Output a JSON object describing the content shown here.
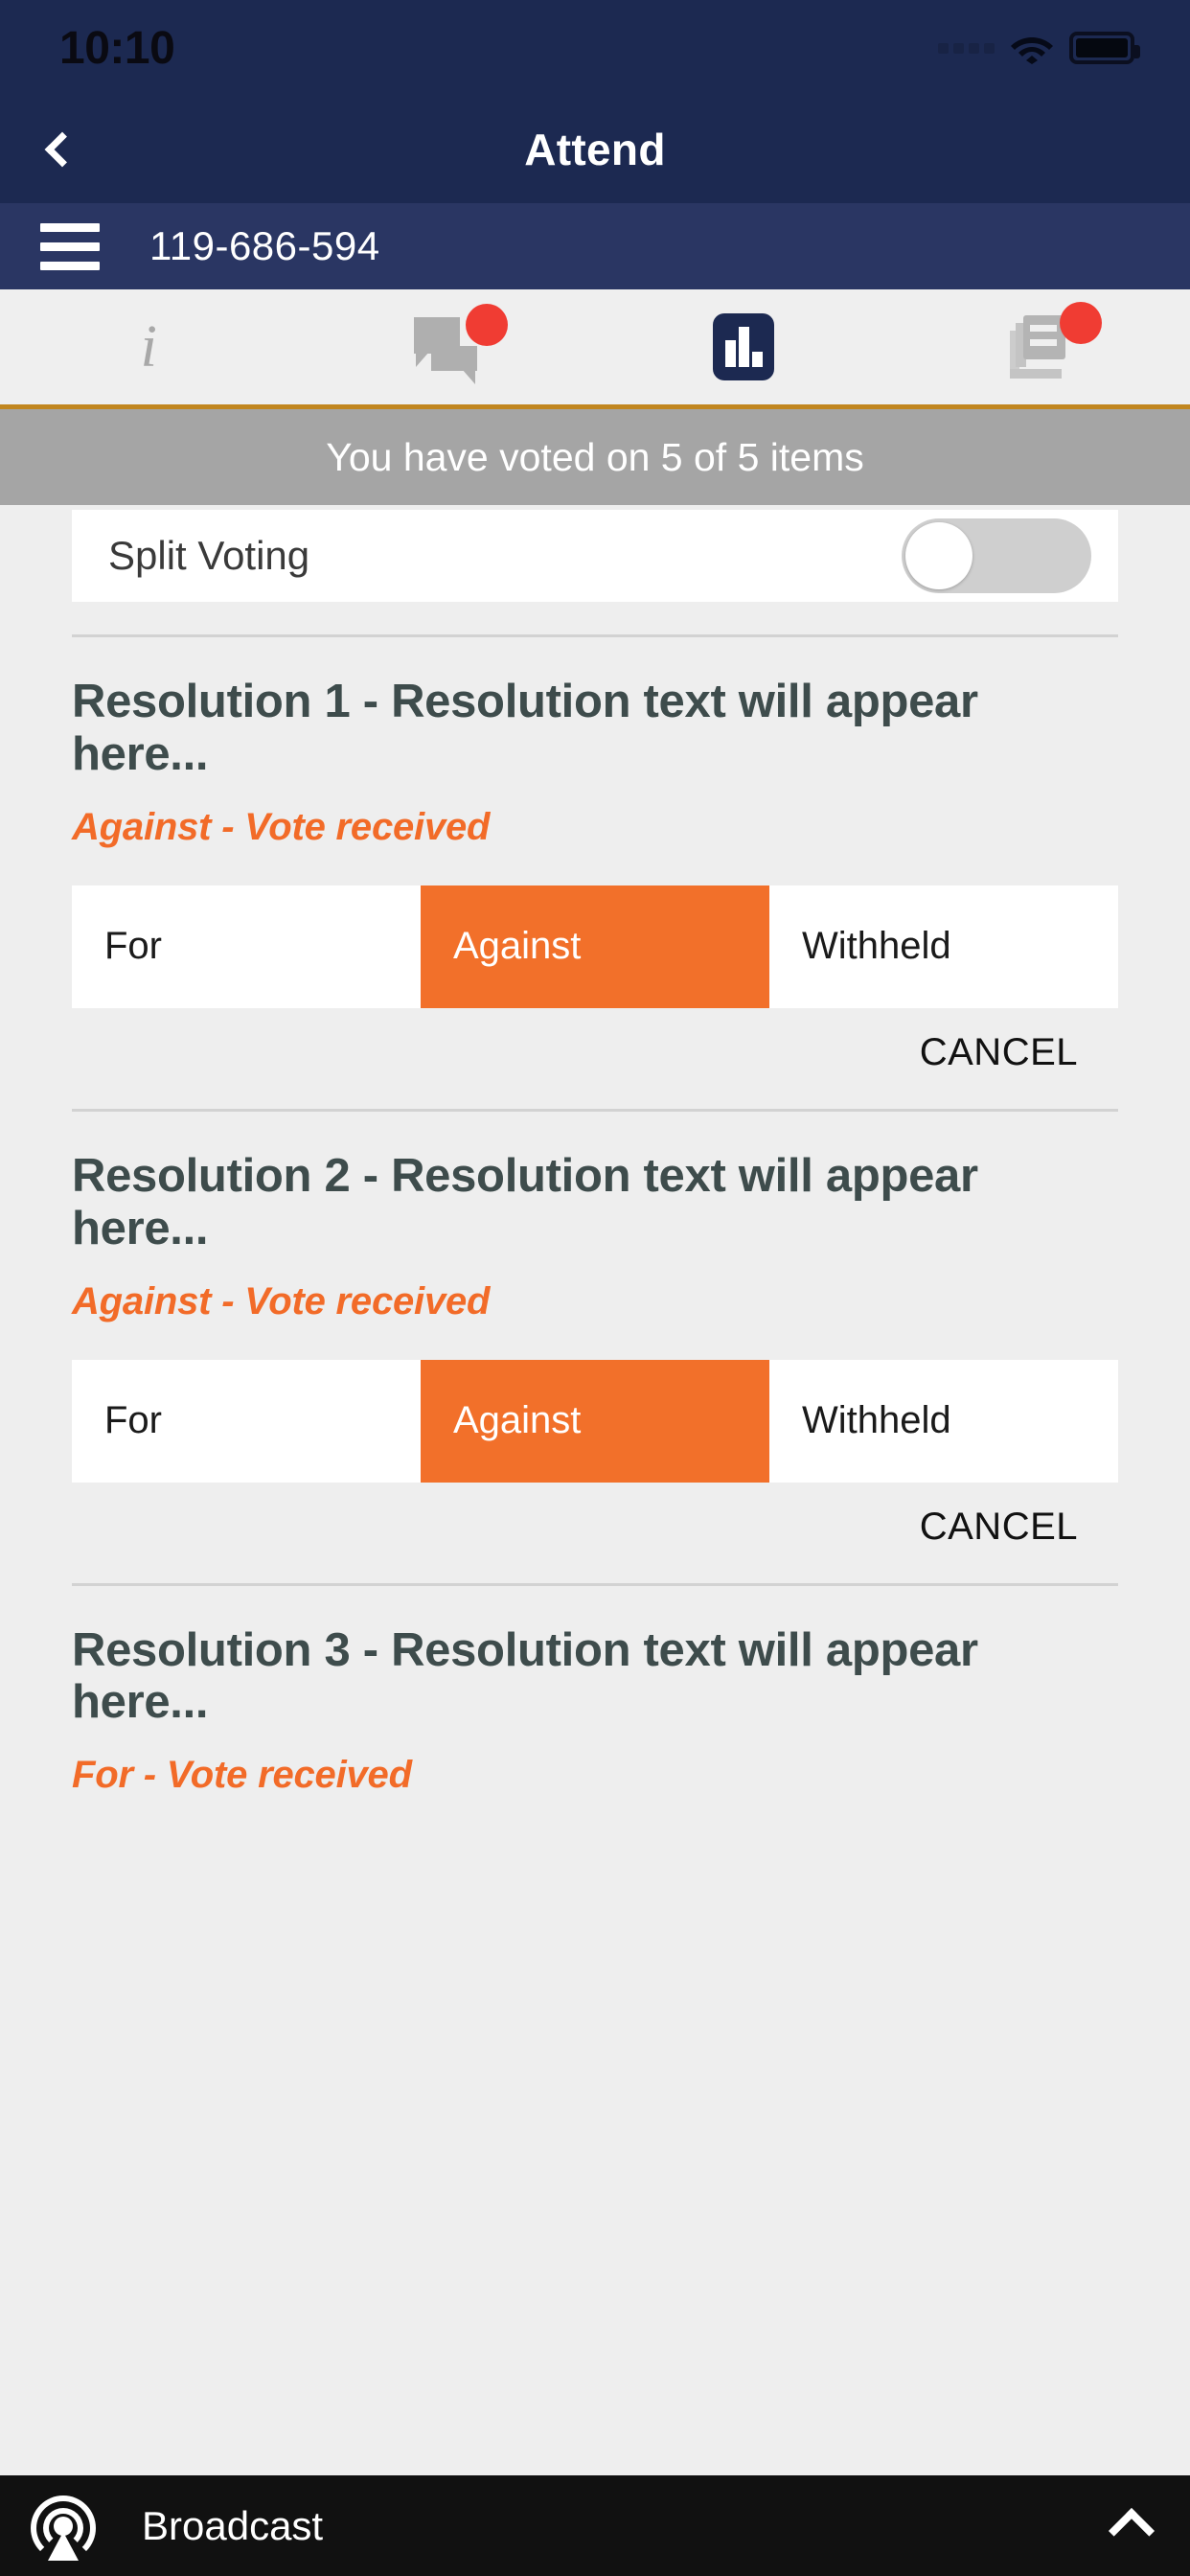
{
  "status_bar": {
    "time": "10:10",
    "signal_icon": "signal-dots-icon",
    "wifi_icon": "wifi-icon",
    "battery_icon": "battery-icon"
  },
  "title_bar": {
    "back_icon": "chevron-left-icon",
    "title": "Attend"
  },
  "id_bar": {
    "menu_icon": "hamburger-menu-icon",
    "meeting_id": "119-686-594"
  },
  "tabs": [
    {
      "name": "info",
      "icon": "info-icon",
      "label": "i",
      "active": false,
      "badge": false
    },
    {
      "name": "messages",
      "icon": "chat-icon",
      "label": "",
      "active": false,
      "badge": true
    },
    {
      "name": "voting",
      "icon": "bar-chart-icon",
      "label": "",
      "active": true,
      "badge": false
    },
    {
      "name": "documents",
      "icon": "documents-icon",
      "label": "",
      "active": false,
      "badge": true
    }
  ],
  "banner": {
    "text": "You have voted on 5 of 5 items"
  },
  "split_voting": {
    "label": "Split Voting",
    "enabled": false
  },
  "vote_options": [
    "For",
    "Against",
    "Withheld"
  ],
  "cancel_label": "CANCEL",
  "resolutions": [
    {
      "title": "Resolution 1 - Resolution text will appear here...",
      "status": "Against - Vote received",
      "selected": "Against"
    },
    {
      "title": "Resolution 2 - Resolution text will appear here...",
      "status": "Against - Vote received",
      "selected": "Against"
    },
    {
      "title": "Resolution 3 - Resolution text will appear here...",
      "status": "For - Vote received",
      "selected": "For"
    }
  ],
  "broadcast": {
    "icon": "broadcast-icon",
    "label": "Broadcast",
    "expand_icon": "chevron-up-icon"
  },
  "colors": {
    "navy": "#1C2951",
    "navy_light": "#2A3663",
    "orange": "#F2702A",
    "orange_text": "#F26B28",
    "amber_rule": "#C1861F",
    "banner_gray": "#A5A5A5",
    "page_bg": "#EEEEEE",
    "badge_red": "#F03C33"
  }
}
